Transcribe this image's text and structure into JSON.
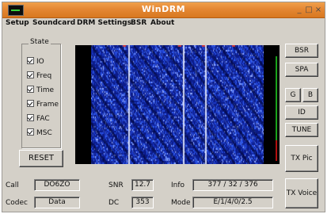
{
  "window": {
    "title": "WinDRM"
  },
  "titlebar_buttons": {
    "minimize": "_",
    "maximize": "□",
    "close": "×"
  },
  "menu": [
    {
      "label": "Setup"
    },
    {
      "label": "Soundcard"
    },
    {
      "label": "DRM Settings"
    },
    {
      "label": "BSR"
    },
    {
      "label": "About"
    }
  ],
  "state": {
    "title": "State",
    "items": [
      {
        "label": "IO",
        "checked": true
      },
      {
        "label": "Freq",
        "checked": true
      },
      {
        "label": "Time",
        "checked": true
      },
      {
        "label": "Frame",
        "checked": true
      },
      {
        "label": "FAC",
        "checked": true
      },
      {
        "label": "MSC",
        "checked": true
      }
    ]
  },
  "buttons": {
    "reset": "RESET",
    "bsr": "BSR",
    "spa": "SPA",
    "g": "G",
    "b": "B",
    "id": "ID",
    "tune": "TUNE",
    "tx_pic": "TX Pic",
    "tx_voice": "TX Voice"
  },
  "info_fields": {
    "call_label": "Call",
    "call_value": "DO6ZO",
    "codec_label": "Codec",
    "codec_value": "Data",
    "snr_label": "SNR",
    "snr_value": "12.7",
    "dc_label": "DC",
    "dc_value": "353",
    "info_label": "Info",
    "info_value": "377 / 32 / 376",
    "mode_label": "Mode",
    "mode_value": "E/1/4/0/2.5"
  },
  "colors": {
    "title_orange": "#e48734",
    "spectrum_bg": "#000000",
    "waterfall_blue": "#1f45e0"
  }
}
